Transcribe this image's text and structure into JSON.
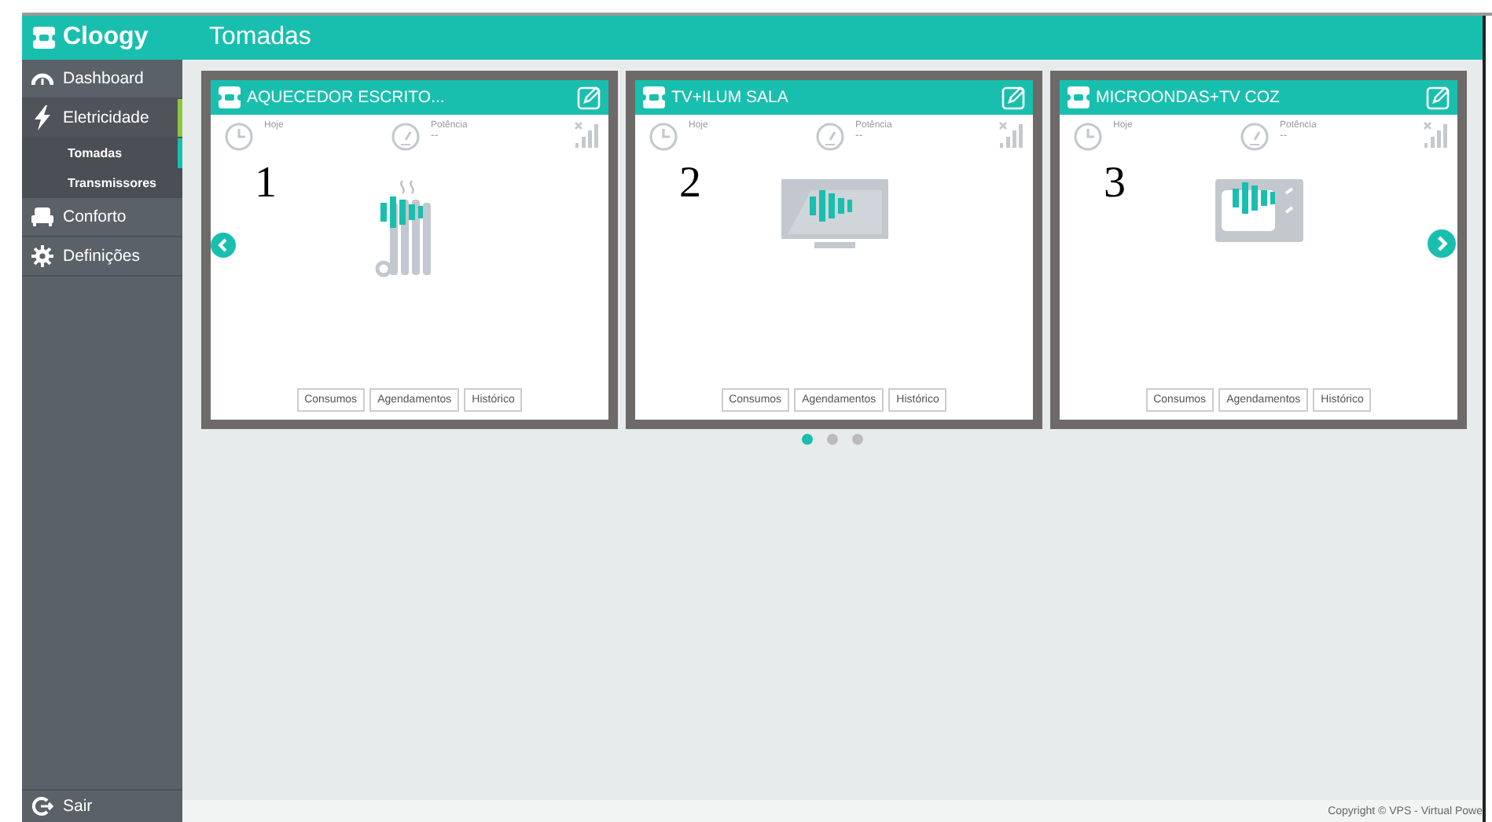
{
  "header": {
    "logo": "Cloogy",
    "page_title": "Tomadas"
  },
  "sidebar": {
    "items": [
      {
        "label": "Dashboard",
        "kind": "gauge",
        "selected": false
      },
      {
        "label": "Eletricidade",
        "kind": "bolt",
        "selected": true,
        "children": [
          {
            "label": "Tomadas",
            "selected": true
          },
          {
            "label": "Transmissores",
            "selected": false
          }
        ]
      },
      {
        "label": "Conforto",
        "kind": "sofa",
        "selected": false
      },
      {
        "label": "Definições",
        "kind": "gear",
        "selected": false
      }
    ],
    "logout": "Sair"
  },
  "devices": [
    {
      "name": "AQUECEDOR ESCRITO...",
      "kind": "heater",
      "annotation": "1",
      "today_label": "Hoje",
      "power_label": "Potência",
      "power_value": "--",
      "buttons": [
        "Consumos",
        "Agendamentos",
        "Histórico"
      ]
    },
    {
      "name": "TV+ILUM SALA",
      "kind": "tv",
      "annotation": "2",
      "today_label": "Hoje",
      "power_label": "Potência",
      "power_value": "--",
      "buttons": [
        "Consumos",
        "Agendamentos",
        "Histórico"
      ]
    },
    {
      "name": "MICROONDAS+TV COZ",
      "kind": "microwave",
      "annotation": "3",
      "today_label": "Hoje",
      "power_label": "Potência",
      "power_value": "--",
      "buttons": [
        "Consumos",
        "Agendamentos",
        "Histórico"
      ]
    }
  ],
  "pager": [
    {
      "selected": true
    },
    {
      "selected": false
    },
    {
      "selected": false
    }
  ],
  "footer": {
    "copyright": "Copyright © VPS - Virtual Powe"
  }
}
